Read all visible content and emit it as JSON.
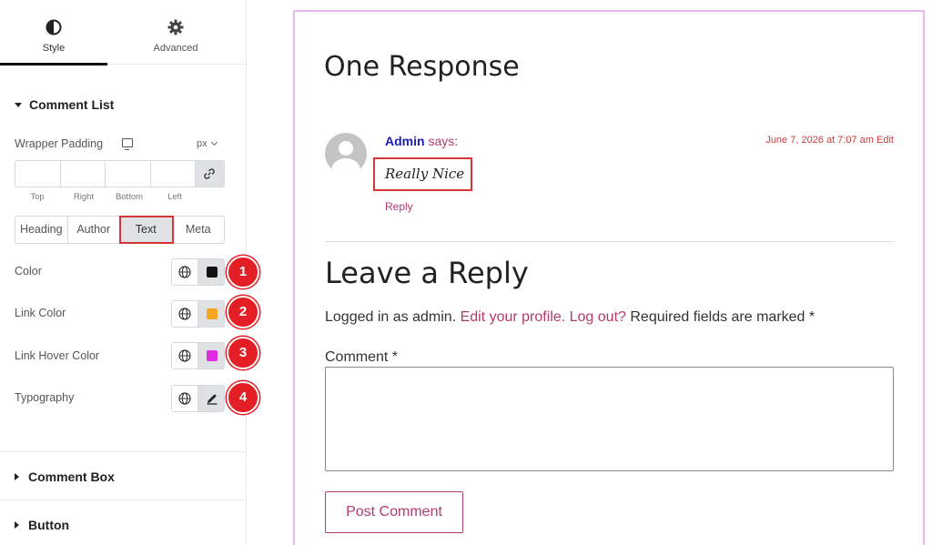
{
  "panel": {
    "tabs": [
      {
        "label": "Style",
        "icon": "half-circle-icon",
        "active": true
      },
      {
        "label": "Advanced",
        "icon": "gear-icon",
        "active": false
      }
    ],
    "comment_list": {
      "title": "Comment List",
      "wrapper_padding_label": "Wrapper Padding",
      "unit": "px",
      "dimension_labels": [
        "Top",
        "Right",
        "Bottom",
        "Left"
      ],
      "segments": [
        "Heading",
        "Author",
        "Text",
        "Meta"
      ],
      "active_segment": "Text",
      "controls": [
        {
          "label": "Color",
          "swatch": "#111111",
          "badge": "1"
        },
        {
          "label": "Link Color",
          "swatch": "#f5a623",
          "badge": "2"
        },
        {
          "label": "Link Hover Color",
          "swatch": "#e02ce0",
          "badge": "3"
        },
        {
          "label": "Typography",
          "badge": "4"
        }
      ]
    },
    "comment_box": {
      "title": "Comment Box"
    },
    "button_section": {
      "title": "Button"
    }
  },
  "preview": {
    "responses_title": "One Response",
    "comment": {
      "author": "Admin",
      "says": "says:",
      "date": "June 7, 2026 at 7:07 am",
      "edit": "Edit",
      "text": "Really Nice",
      "reply": "Reply"
    },
    "leave_reply_title": "Leave a Reply",
    "logged_in": {
      "prefix": "Logged in as admin.",
      "edit_profile": "Edit your profile.",
      "log_out": "Log out?",
      "suffix": "Required fields are marked *"
    },
    "comment_label": "Comment *",
    "post_button": "Post Comment"
  },
  "colors": {
    "accent_red": "#d63638",
    "badge_red": "#e31e24",
    "link": "#b33a6d",
    "author": "#1a20b8",
    "preview_border": "#e9b6ef"
  }
}
